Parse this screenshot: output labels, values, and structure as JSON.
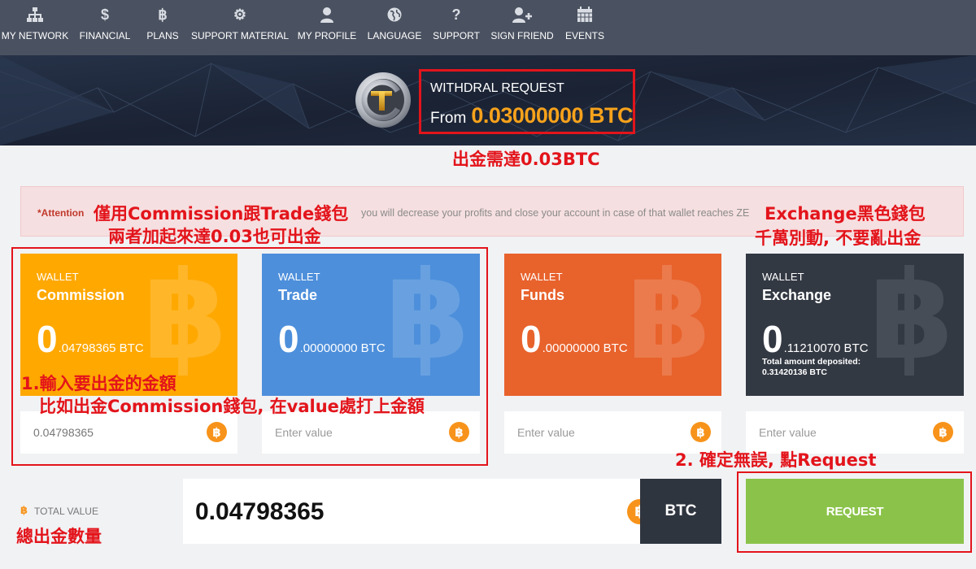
{
  "nav": {
    "items": [
      {
        "label": "MY NETWORK",
        "icon": "network-icon"
      },
      {
        "label": "FINANCIAL",
        "icon": "dollar-icon"
      },
      {
        "label": "PLANS",
        "icon": "bitcoin-icon"
      },
      {
        "label": "SUPPORT MATERIAL",
        "icon": "gear-icon"
      },
      {
        "label": "MY PROFILE",
        "icon": "user-icon"
      },
      {
        "label": "LANGUAGE",
        "icon": "globe-icon"
      },
      {
        "label": "SUPPORT",
        "icon": "question-icon"
      },
      {
        "label": "SIGN FRIEND",
        "icon": "user-plus-icon"
      },
      {
        "label": "EVENTS",
        "icon": "calendar-icon"
      }
    ]
  },
  "banner": {
    "title": "WITHDRAL REQUEST",
    "from_label": "From",
    "min_amount": "0.03000000 BTC"
  },
  "annotations": {
    "min_note": "出金需達0.03BTC",
    "wallets_note_1": "僅用Commission跟Trade錢包",
    "wallets_note_2": "兩者加起來達0.03也可出金",
    "exchange_note_1": "Exchange黑色錢包",
    "exchange_note_2": "千萬別動, 不要亂出金",
    "step1_line1": "1.輸入要出金的金額",
    "step1_line2": "比如出金Commission錢包, 在value處打上金額",
    "step2": "2. 確定無誤, 點Request",
    "total_note": "總出金數量"
  },
  "attention": {
    "label": "*Attention",
    "text": "you will decrease your profits and close your account in case of that wallet reaches ZE"
  },
  "wallets": [
    {
      "label": "WALLET",
      "name": "Commission",
      "int": "0",
      "dec": ".04798365 BTC",
      "color": "#ffa800",
      "input_value": "0.04798365",
      "placeholder": "Enter value"
    },
    {
      "label": "WALLET",
      "name": "Trade",
      "int": "0",
      "dec": ".00000000 BTC",
      "color": "#4d8fdb",
      "input_value": "",
      "placeholder": "Enter value"
    },
    {
      "label": "WALLET",
      "name": "Funds",
      "int": "0",
      "dec": ".00000000 BTC",
      "color": "#e8622c",
      "input_value": "",
      "placeholder": "Enter value"
    },
    {
      "label": "WALLET",
      "name": "Exchange",
      "int": "0",
      "dec": ".11210070 BTC",
      "color": "#333943",
      "input_value": "",
      "placeholder": "Enter value",
      "deposit_label": "Total amount deposited:",
      "deposit_value": "0.31420136 BTC"
    }
  ],
  "total": {
    "label": "TOTAL VALUE",
    "value": "0.04798365",
    "unit": "BTC"
  },
  "request_label": "REQUEST",
  "colors": {
    "nav_bg": "#4a5160",
    "accent_orange": "#f7a21b",
    "request_green": "#8bc34a",
    "annotation_red": "#e3141b"
  }
}
